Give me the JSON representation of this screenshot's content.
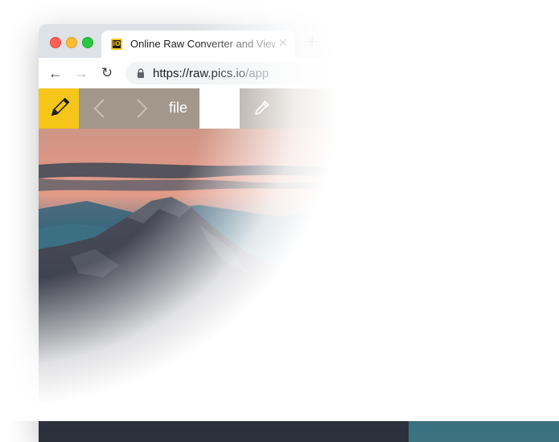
{
  "browser": {
    "tab": {
      "favicon_text": "iO",
      "title": "Online Raw Converter and Viewer",
      "close_glyph": "✕"
    },
    "new_tab_glyph": "+",
    "nav": {
      "back_glyph": "←",
      "forward_glyph": "→",
      "reload_glyph": "↻"
    },
    "address": {
      "scheme": "https://",
      "host": "raw.pics.io",
      "path": "/app"
    }
  },
  "app_toolbar": {
    "edit_icon": "pencil-icon",
    "prev_icon": "chevron-left-icon",
    "next_icon": "chevron-right-icon",
    "file_label": "file",
    "eyedropper_icon": "eyedropper-icon",
    "accent_color": "#f6c519"
  }
}
